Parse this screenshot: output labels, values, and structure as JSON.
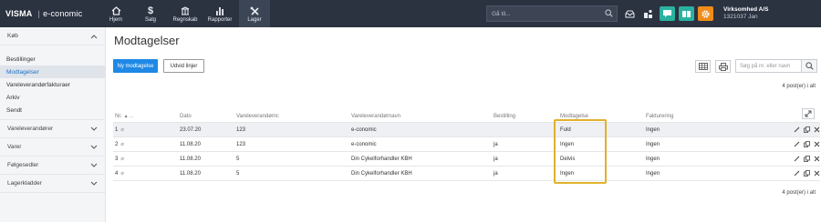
{
  "topbar": {
    "brand": "VISMA",
    "product": "e-conomic",
    "nav": [
      {
        "label": "Hjem",
        "icon": "home-icon"
      },
      {
        "label": "Salg",
        "icon": "dollar-icon"
      },
      {
        "label": "Regnskab",
        "icon": "ledger-icon"
      },
      {
        "label": "Rapporter",
        "icon": "bar-chart-icon"
      },
      {
        "label": "Lager",
        "icon": "tools-icon"
      }
    ],
    "search_placeholder": "Gå til...",
    "company_name": "Virksomhed A/S",
    "company_id": "1321037 Jan",
    "colors": {
      "bar": "#2b3240",
      "chat": "#2ab1a0",
      "docs": "#2ab1a0",
      "settings": "#f08c1a"
    }
  },
  "sidebar": {
    "sections": [
      {
        "label": "Køb",
        "expanded": true,
        "items": [
          "Bestillinger",
          "Modtagelser",
          "Vareleverandørfakturaer",
          "Arkiv",
          "Sendt"
        ],
        "active_index": 1
      },
      {
        "label": "Vareleverandører",
        "expanded": false
      },
      {
        "label": "Varer",
        "expanded": false
      },
      {
        "label": "Følgesedler",
        "expanded": false
      },
      {
        "label": "Lagerkladder",
        "expanded": false
      }
    ]
  },
  "main": {
    "title": "Modtagelser",
    "new_button": "Ny modtagelse",
    "expand_button": "Udvid linjer",
    "search_placeholder": "Søg på nr. eller navn",
    "count_top": "4 post(er) i alt",
    "count_bottom": "4 post(er) i alt",
    "columns": [
      "Nr.",
      "Dato",
      "Vareleverandørnr.",
      "Vareleverandørnavn",
      "Bestilling",
      "Modtagelse",
      "Fakturering"
    ],
    "rows": [
      {
        "nr": "1",
        "dato": "23.07.20",
        "levnr": "123",
        "levnavn": "e-conomic",
        "bestilling": "",
        "modtagelse": "Fuld",
        "fakturering": "Ingen"
      },
      {
        "nr": "2",
        "dato": "11.08.20",
        "levnr": "123",
        "levnavn": "e-conomic",
        "bestilling": "ja",
        "modtagelse": "Ingen",
        "fakturering": "Ingen"
      },
      {
        "nr": "3",
        "dato": "11.08.20",
        "levnr": "5",
        "levnavn": "Din Cykelforhandler KBH",
        "bestilling": "ja",
        "modtagelse": "Delvis",
        "fakturering": "Ingen"
      },
      {
        "nr": "4",
        "dato": "11.08.20",
        "levnr": "5",
        "levnavn": "Din Cykelforhandler KBH",
        "bestilling": "ja",
        "modtagelse": "Ingen",
        "fakturering": "Ingen"
      }
    ],
    "highlight_color": "#e0b12a"
  }
}
